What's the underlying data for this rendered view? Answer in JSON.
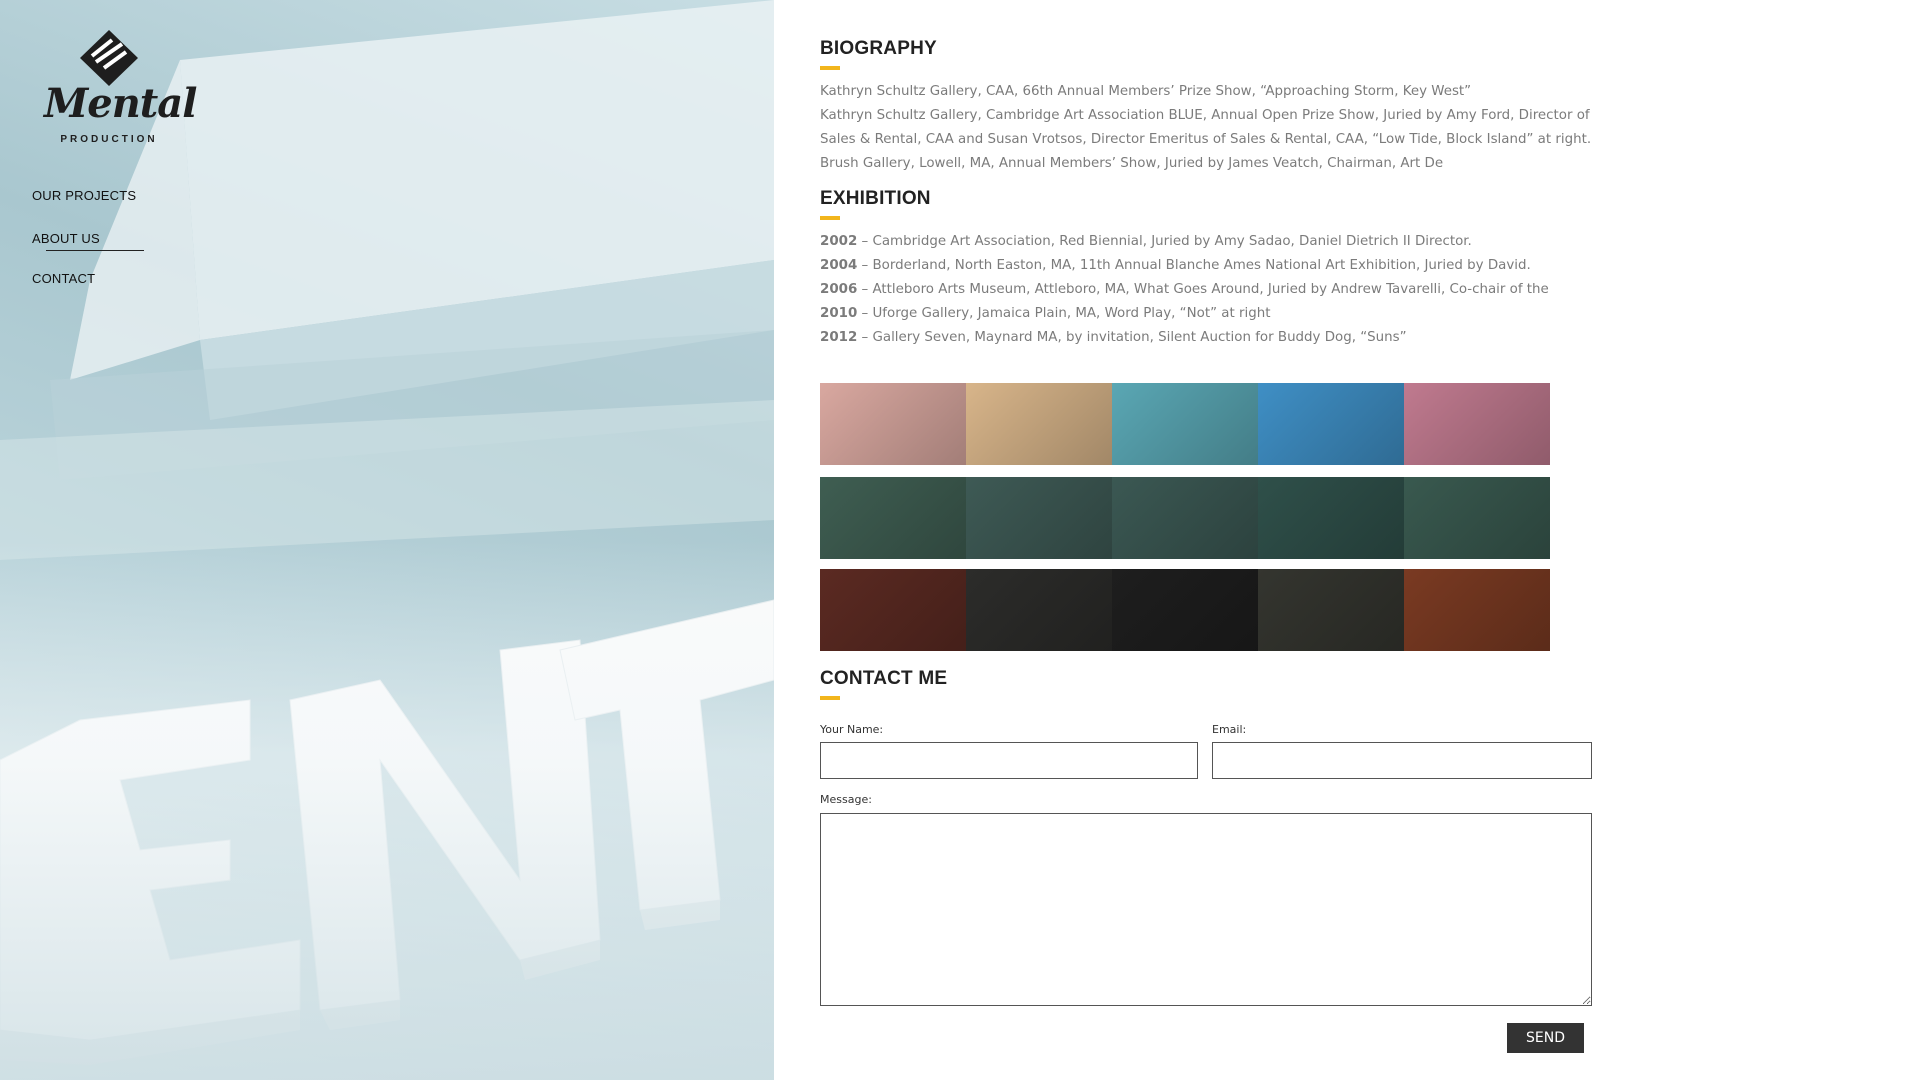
{
  "brand": {
    "name": "Mental",
    "tagline": "PRODUCTION"
  },
  "nav": {
    "items": [
      {
        "label": "OUR PROJECTS"
      },
      {
        "label": "ABOUT US"
      },
      {
        "label": "CONTACT"
      }
    ]
  },
  "biography": {
    "title": "BIOGRAPHY",
    "lines": [
      "Kathryn Schultz Gallery, CAA, 66th Annual Members’ Prize Show, “Approaching Storm, Key West”",
      "Kathryn Schultz Gallery, Cambridge Art Association BLUE, Annual Open Prize Show, Juried by Amy Ford, Director of",
      "Sales & Rental, CAA and Susan Vrotsos, Director Emeritus of Sales & Rental, CAA, “Low Tide, Block Island” at right.",
      "Brush Gallery, Lowell, MA, Annual Members’ Show, Juried by James Veatch, Chairman, Art De"
    ]
  },
  "exhibition": {
    "title": "EXHIBITION",
    "items": [
      {
        "year": "2002",
        "text": " – Cambridge Art Association, Red Biennial, Juried by Amy Sadao, Daniel Dietrich II Director."
      },
      {
        "year": "2004",
        "text": " – Borderland, North Easton, MA, 11th Annual Blanche Ames National Art Exhibition, Juried by David."
      },
      {
        "year": "2006",
        "text": " – Attleboro Arts Museum, Attleboro, MA, What Goes Around, Juried by Andrew Tavarelli, Co-chair of the"
      },
      {
        "year": "2010",
        "text": " – Uforge Gallery, Jamaica Plain, MA, Word Play, “Not” at right"
      },
      {
        "year": "2012",
        "text": " – Gallery Seven, Maynard MA, by invitation, Silent Auction for Buddy Dog, “Suns”"
      }
    ]
  },
  "gallery": {
    "strips": [
      {
        "tiles": [
          "#d9a8a0",
          "#d8b58a",
          "#5aa7b4",
          "#3f8fc5",
          "#c07a8f"
        ]
      },
      {
        "tiles": [
          "#3f5e52",
          "#3e5a55",
          "#3b5853",
          "#2f504a",
          "#39594f"
        ]
      },
      {
        "tiles": [
          "#5b2a22",
          "#2c2c2a",
          "#1e1e1e",
          "#34352f",
          "#7a3a22"
        ]
      }
    ]
  },
  "contact": {
    "title": "CONTACT ME",
    "name_label": "Your Name:",
    "email_label": "Email:",
    "message_label": "Message:",
    "name_value": "",
    "email_value": "",
    "message_value": "",
    "send_label": "SEND"
  },
  "colors": {
    "accent": "#f2b51c",
    "button": "#333333"
  }
}
